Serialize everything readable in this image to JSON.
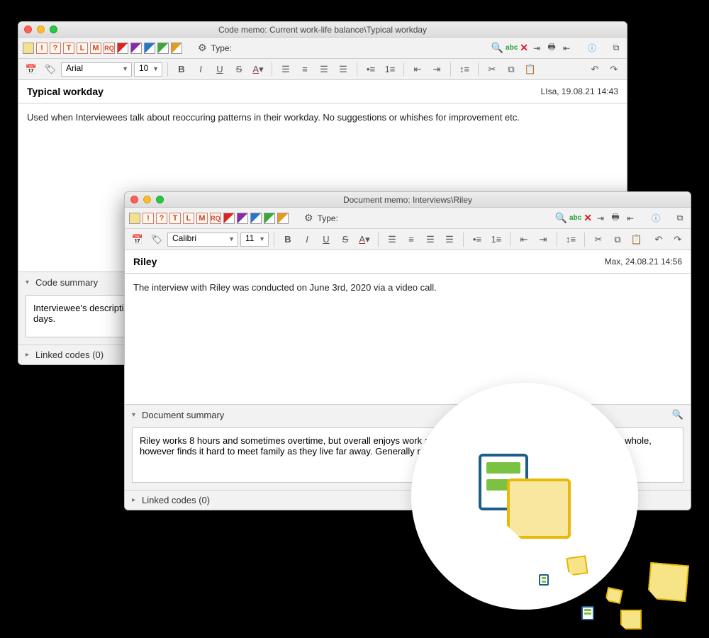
{
  "window1": {
    "title": "Code memo: Current work-life balance\\Typical workday",
    "typeLabel": "Type:",
    "font": "Arial",
    "fontSize": "10",
    "docTitle": "Typical workday",
    "docMeta": "LIsa, 19.08.21 14:43",
    "body": "Used when Interviewees talk about reoccuring patterns in their workday. No suggestions or whishes for improvement etc.",
    "summaryLabel": "Code summary",
    "summaryText": "Interviewee's description of a typical workday: start, breaks, amount of worked hours, end of day, as well as how the day is structured most days.",
    "linkedLabel": "Linked codes (0)"
  },
  "window2": {
    "title": "Document memo: Interviews\\Riley",
    "typeLabel": "Type:",
    "font": "Calibri",
    "fontSize": "11",
    "docTitle": "Riley",
    "docMeta": "Max, 24.08.21 14:56",
    "body": "The interview with Riley was conducted on June 3rd, 2020 via a video call.",
    "summaryLabel": "Document summary",
    "summaryText": "Riley works 8 hours and sometimes overtime, but overall enjoys work and seems to be satisfied with relationships as a whole, however finds it hard to meet family as they live far away. Generally rather likes the option to work from home.",
    "linkedLabel": "Linked codes (0)"
  },
  "colorSquares": [
    {
      "c": "#f5e08f"
    },
    {
      "t": "letter",
      "l": "!"
    },
    {
      "t": "letter",
      "l": "?"
    },
    {
      "t": "letter",
      "l": "T"
    },
    {
      "t": "letter",
      "l": "L"
    },
    {
      "t": "letter",
      "l": "M"
    },
    {
      "t": "letter",
      "l": "RQ"
    },
    {
      "t": "diag",
      "c1": "#d22",
      "c2": "#fff"
    },
    {
      "t": "diag",
      "c1": "#8929a8",
      "c2": "#fff"
    },
    {
      "t": "diag",
      "c1": "#2578c9",
      "c2": "#fff"
    },
    {
      "t": "diag",
      "c1": "#38a838",
      "c2": "#fff"
    },
    {
      "t": "diag",
      "c1": "#e89b19",
      "c2": "#fff"
    }
  ]
}
